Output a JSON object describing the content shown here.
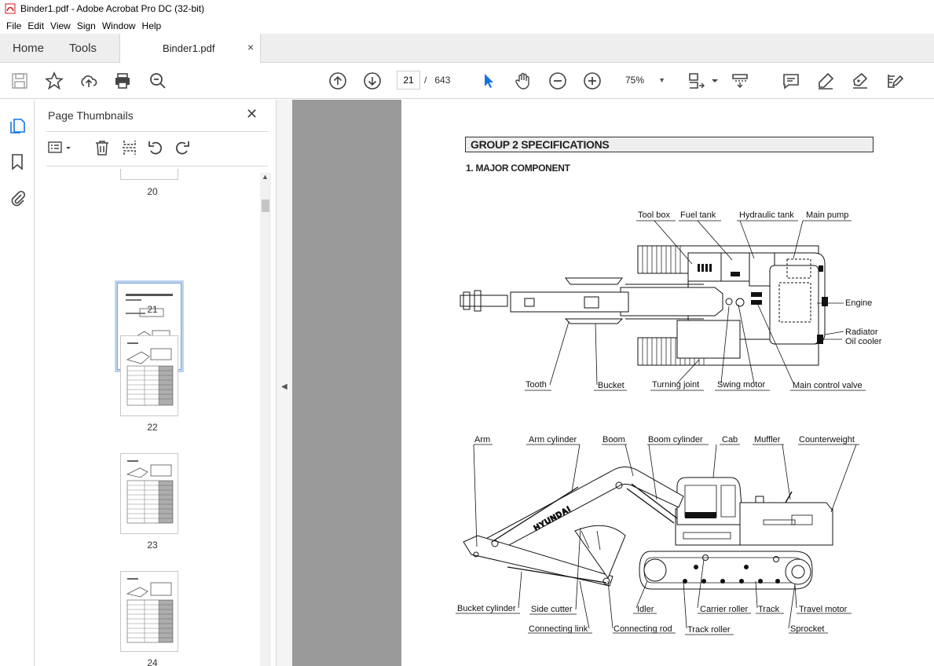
{
  "window": {
    "title": "Binder1.pdf - Adobe Acrobat Pro DC (32-bit)"
  },
  "menu": [
    "File",
    "Edit",
    "View",
    "Sign",
    "Window",
    "Help"
  ],
  "tabs": {
    "home": "Home",
    "tools": "Tools",
    "document": "Binder1.pdf",
    "close": "×"
  },
  "toolbar": {
    "current_page": "21",
    "page_sep": "/",
    "total_pages": "643",
    "zoom": "75%"
  },
  "thumbnails_panel": {
    "title": "Page Thumbnails",
    "close": "✕",
    "pages": [
      {
        "number": "20"
      },
      {
        "number": "21",
        "selected": true
      },
      {
        "number": "22"
      },
      {
        "number": "23"
      },
      {
        "number": "24"
      }
    ]
  },
  "document": {
    "group_title": "GROUP  2  SPECIFICATIONS",
    "section_title": "1.  MAJOR COMPONENT",
    "top_labels": {
      "tool_box": "Tool box",
      "fuel_tank": "Fuel tank",
      "hydraulic_tank": "Hydraulic tank",
      "main_pump": "Main pump",
      "engine": "Engine",
      "radiator": "Radiator",
      "oil_cooler": "Oil cooler",
      "tooth": "Tooth",
      "bucket": "Bucket",
      "turning_joint": "Turning joint",
      "swing_motor": "Swing motor",
      "main_control_valve": "Main control valve"
    },
    "side_labels": {
      "arm": "Arm",
      "arm_cylinder": "Arm cylinder",
      "boom": "Boom",
      "boom_cylinder": "Boom cylinder",
      "cab": "Cab",
      "muffler": "Muffler",
      "counterweight": "Counterweight",
      "bucket_cylinder": "Bucket cylinder",
      "side_cutter": "Side cutter",
      "connecting_link": "Connecting link",
      "idler": "Idler",
      "connecting_rod": "Connecting rod",
      "carrier_roller": "Carrier roller",
      "track_roller": "Track roller",
      "track": "Track",
      "travel_motor": "Travel motor",
      "sprocket": "Sprocket"
    },
    "brand": "HYUNDAI"
  },
  "colors": {
    "accent": "#1473e6",
    "canvas": "#9a9a9a",
    "selected_thumb": "#bcd3ee"
  }
}
